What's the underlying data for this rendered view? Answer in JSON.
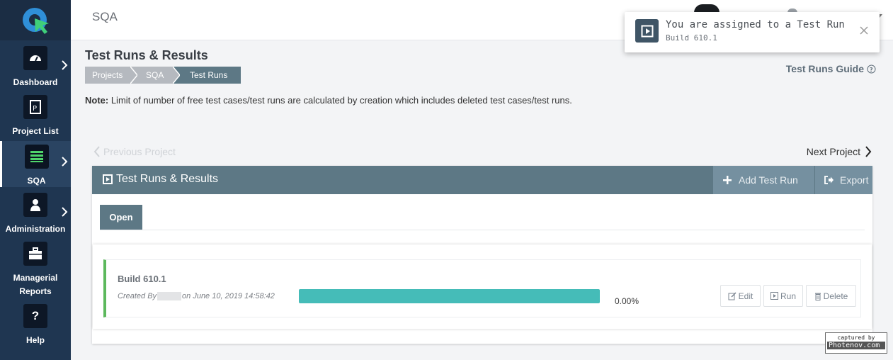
{
  "topbar": {
    "title": "SQA"
  },
  "sidebar": {
    "items": [
      {
        "label": "Dashboard"
      },
      {
        "label": "Project List"
      },
      {
        "label": "SQA"
      },
      {
        "label": "Administration"
      },
      {
        "label": "Managerial Reports"
      },
      {
        "label": "Help"
      }
    ]
  },
  "header": {
    "title": "Test Runs & Results",
    "breadcrumb": [
      "Projects",
      "SQA",
      "Test Runs"
    ],
    "guide_label": "Test Runs Guide",
    "note_label": "Note:",
    "note_text": " Limit of number of free test cases/test runs are calculated by creation which includes deleted test cases/test runs."
  },
  "nav": {
    "prev_label": "Previous Project",
    "next_label": "Next Project"
  },
  "panel": {
    "title": "Test Runs & Results",
    "add_label": "Add Test Run",
    "export_label": "Export",
    "tab_open": "Open"
  },
  "run": {
    "name": "Build 610.1",
    "created_prefix": "Created By",
    "created_suffix": "on June 10, 2019 14:58:42",
    "percent": "0.00%",
    "progress_fraction": 1.0,
    "edit_label": "Edit",
    "run_label": "Run",
    "delete_label": "Delete"
  },
  "toast": {
    "title": "You are assigned to a Test Run",
    "subtitle": "Build 610.1"
  },
  "watermark": {
    "line1": "captured by",
    "line2": "Photenov.com"
  },
  "colors": {
    "sidebar": "#1f3651",
    "accent": "#5d7885",
    "progress": "#45bcb8",
    "success": "#5cb85c"
  }
}
